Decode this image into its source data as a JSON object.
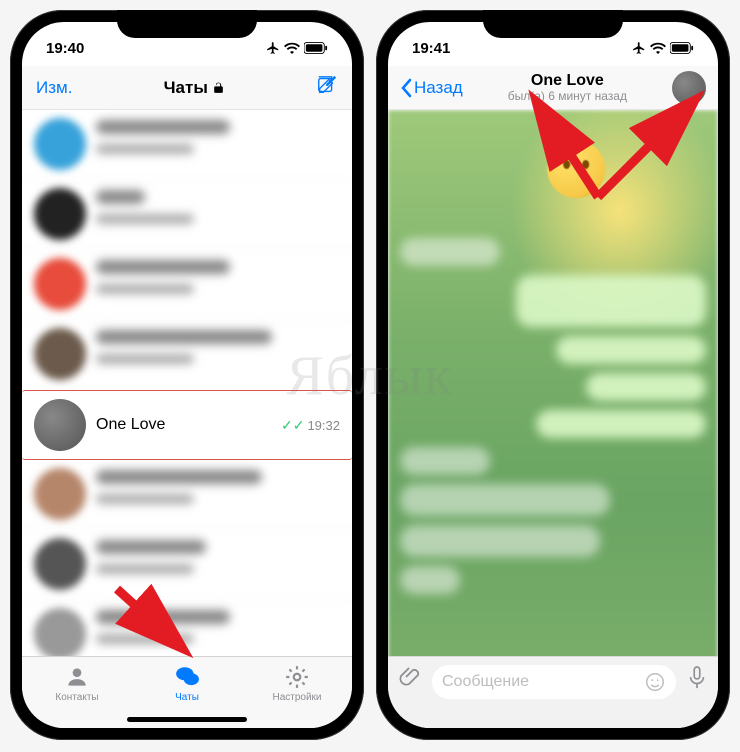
{
  "watermark": "Яблык",
  "left": {
    "status": {
      "time": "19:40"
    },
    "nav": {
      "edit": "Изм.",
      "title": "Чаты"
    },
    "highlighted_chat": {
      "name": "One Love",
      "time": "19:32"
    },
    "tabs": {
      "contacts": "Контакты",
      "chats": "Чаты",
      "settings": "Настройки"
    }
  },
  "right": {
    "status": {
      "time": "19:41"
    },
    "nav": {
      "back": "Назад",
      "title": "One Love",
      "subtitle": "был(а) 6 минут назад"
    },
    "input": {
      "placeholder": "Сообщение"
    }
  },
  "colors": {
    "accent": "#007aff",
    "arrow": "#e31b23"
  }
}
